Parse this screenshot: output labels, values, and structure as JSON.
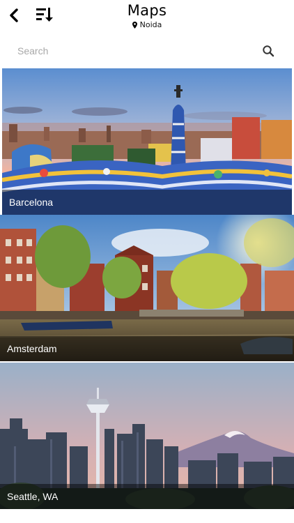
{
  "header": {
    "title": "Maps",
    "location": "Noida"
  },
  "search": {
    "placeholder": "Search",
    "value": ""
  },
  "cities": [
    {
      "name": "Barcelona"
    },
    {
      "name": "Amsterdam"
    },
    {
      "name": "Seattle, WA"
    }
  ],
  "colors": {
    "text": "#000000",
    "placeholder": "#a8a8a8",
    "label": "#ffffff"
  },
  "icons": {
    "back": "chevron-left-icon",
    "sort": "sort-descending-icon",
    "location": "map-pin-icon",
    "search": "search-icon"
  }
}
